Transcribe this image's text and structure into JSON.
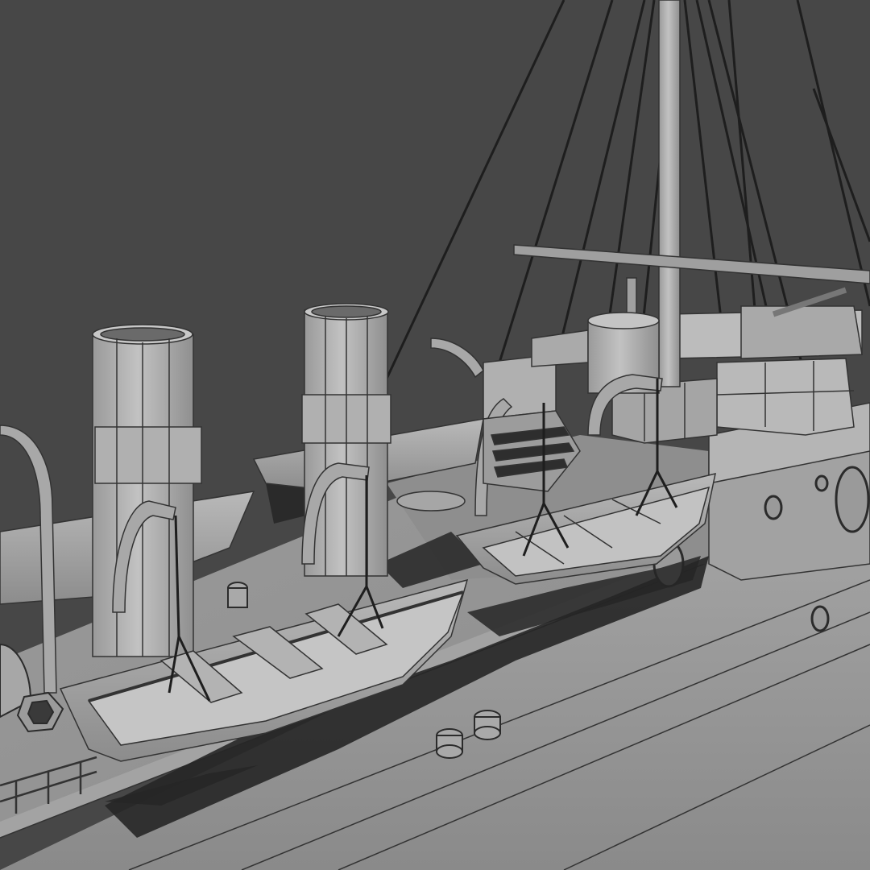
{
  "scene": {
    "description_hidden": "",
    "colors": {
      "background": "#474747",
      "surface_light": "#b4b4b4",
      "surface_mid": "#9d9d9d",
      "surface_dark": "#868686",
      "shadow": "#232323",
      "wire": "#333333",
      "rigging": "#1e1e1e"
    }
  }
}
